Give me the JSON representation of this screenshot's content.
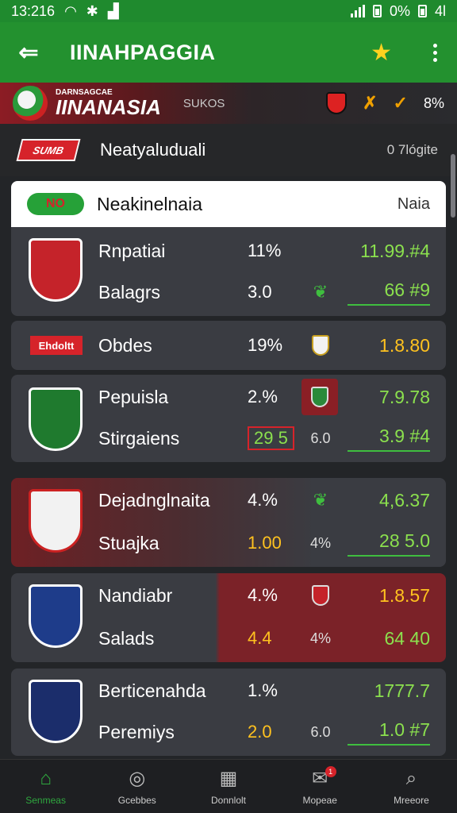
{
  "status_bar": {
    "time": "13:216",
    "battery_text": "0%",
    "right_text": "4l"
  },
  "app_bar": {
    "title": "IINAHPAGGIA"
  },
  "banner": {
    "brand_small": "DARNSAGCAE",
    "brand_big": "IINANASIA",
    "sub": "SUKOS",
    "pct": "8%"
  },
  "section_header": {
    "tag": "SUMB",
    "title": "Neatyaluduali",
    "time": "0 7lógite"
  },
  "list_header": {
    "badge": "NO",
    "title": "Neakinelnaia",
    "right": "Naia"
  },
  "cards": [
    {
      "crest": "red-crest",
      "rows": [
        {
          "team": "Rnpatiai",
          "pct": "11%",
          "odds": "11.99.#4",
          "odds_color": "green"
        },
        {
          "team": "Balagrs",
          "pct": "3.0",
          "mid": "leaf-icon",
          "odds": "66 #9",
          "odds_color": "green"
        }
      ]
    },
    {
      "tag": "Ehdoltt",
      "rows": [
        {
          "team": "Obdes",
          "pct": "19%",
          "mid": "shield-icon",
          "odds": "1.8.80",
          "odds_color": "yellow"
        }
      ]
    },
    {
      "crest": "green-crest",
      "rows": [
        {
          "team": "Pepuisla",
          "pct": "2.%",
          "mid": "shield-icon",
          "odds": "7.9.78",
          "odds_color": "green"
        },
        {
          "team": "Stirgaiens",
          "pct": "29 5",
          "mid_text": "6.0",
          "odds": "3.9 #4",
          "odds_color": "green"
        }
      ]
    },
    {
      "crest": "white-crest",
      "rows": [
        {
          "team": "Dejadnglnaita",
          "pct": "4.%",
          "mid": "leaf-icon",
          "odds": "4,6.37",
          "odds_color": "green"
        },
        {
          "team": "Stuajka",
          "pct": "1.00",
          "mid_text": "4%",
          "odds": "28 5.0",
          "odds_color": "green"
        }
      ]
    },
    {
      "crest": "blue-crest",
      "rows": [
        {
          "team": "Nandiabr",
          "pct": "4.%",
          "mid": "shield-icon",
          "odds": "1.8.57",
          "odds_color": "yellow"
        },
        {
          "team": "Salads",
          "pct": "4.4",
          "mid_text": "4%",
          "odds": "64 40",
          "odds_color": "green"
        }
      ]
    },
    {
      "crest": "navy-crest",
      "rows": [
        {
          "team": "Berticenahda",
          "pct": "1.%",
          "odds": "1777.7",
          "odds_color": "green"
        },
        {
          "team": "Peremiys",
          "pct": "2.0",
          "mid_text": "6.0",
          "odds": "1.0 #7",
          "odds_color": "green"
        }
      ]
    }
  ],
  "bottom_nav": [
    {
      "label": "Senmeas",
      "icon": "home-icon",
      "active": true
    },
    {
      "label": "Gcebbes",
      "icon": "compass-icon"
    },
    {
      "label": "Donnlolt",
      "icon": "grid-icon"
    },
    {
      "label": "Mopeae",
      "icon": "message-icon",
      "badge": "1"
    },
    {
      "label": "Mreeore",
      "icon": "search-icon"
    }
  ],
  "colors": {
    "primary_green": "#23912f",
    "accent_red": "#d6232a",
    "odds_green": "#8be04e",
    "odds_yellow": "#ffc21f",
    "card_bg": "#3a3c42"
  }
}
